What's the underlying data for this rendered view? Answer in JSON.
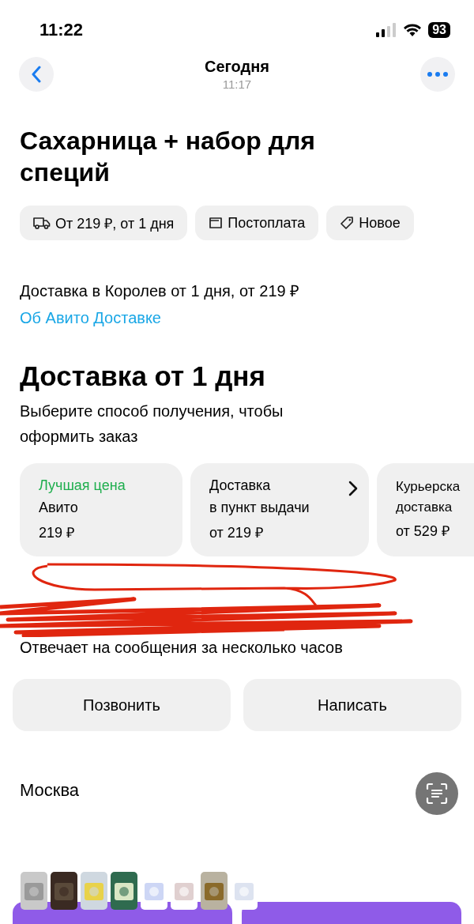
{
  "status_bar": {
    "time": "11:22",
    "battery": "93"
  },
  "nav": {
    "title": "Сегодня",
    "subtitle": "11:17"
  },
  "product": {
    "title": "Сахарница + набор для специй"
  },
  "chips": [
    {
      "kind": "truck",
      "label": "От 219 ₽, от 1 дня"
    },
    {
      "kind": "wallet",
      "label": "Постоплата"
    },
    {
      "kind": "tag",
      "label": "Новое"
    }
  ],
  "delivery_info": {
    "text": "Доставка в Королев от 1 дня, от 219 ₽",
    "link": "Об Авито Доставке"
  },
  "delivery": {
    "heading": "Доставка от 1 дня",
    "subtitle": "Выберите способ получения, чтобы оформить заказ"
  },
  "options": [
    {
      "badge": "Лучшая цена",
      "name": "Авито",
      "price": "219 ₽",
      "arrow": false
    },
    {
      "name": "Доставка\nв пункт выдачи",
      "price": "от 219 ₽",
      "arrow": true
    },
    {
      "name": "Курьерска\nдоставка",
      "price": "от 529 ₽"
    }
  ],
  "seller": {
    "response_time": "Отвечает на сообщения за несколько часов"
  },
  "buttons": [
    "Позвонить",
    "Написать"
  ],
  "city": "Москва"
}
